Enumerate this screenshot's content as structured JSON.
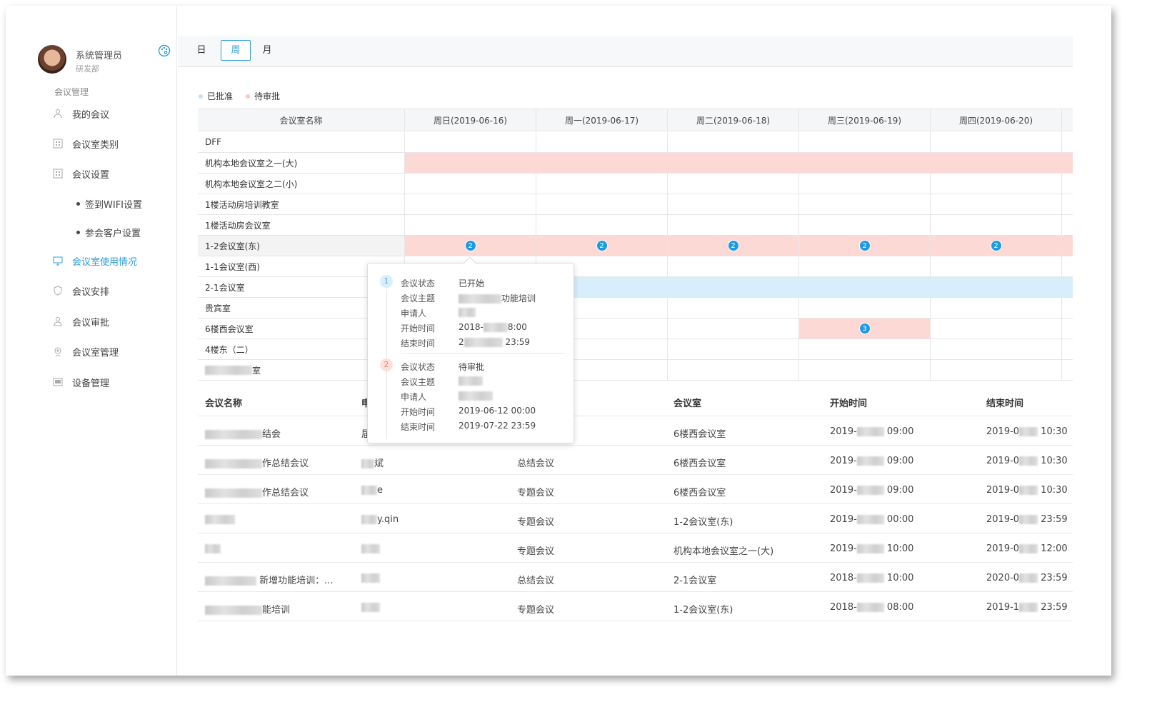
{
  "user": {
    "name": "系统管理员",
    "dept": "研发部"
  },
  "nav": {
    "section_title": "会议管理",
    "items": [
      {
        "label": "我的会议",
        "icon": "users-icon"
      },
      {
        "label": "会议室类别",
        "icon": "grid-icon"
      },
      {
        "label": "会议设置",
        "icon": "grid-icon"
      },
      {
        "label": "会议室使用情况",
        "icon": "monitor-icon",
        "active": true
      },
      {
        "label": "会议安排",
        "icon": "shield-icon"
      },
      {
        "label": "会议审批",
        "icon": "user-check-icon"
      },
      {
        "label": "会议室管理",
        "icon": "projector-icon"
      },
      {
        "label": "设备管理",
        "icon": "device-icon"
      }
    ],
    "sub_items": [
      "签到WIFI设置",
      "参会客户设置"
    ]
  },
  "tabs": [
    {
      "label": "日"
    },
    {
      "label": "周",
      "active": true
    },
    {
      "label": "月"
    }
  ],
  "legend": {
    "approved": "已批准",
    "pending": "待审批",
    "approved_color": "#d7eefb",
    "pending_color": "#fdd9d5"
  },
  "schedule": {
    "header": [
      "会议室名称",
      "周日(2019-06-16)",
      "周一(2019-06-17)",
      "周二(2019-06-18)",
      "周三(2019-06-19)",
      "周四(2019-06-20)"
    ],
    "rooms": [
      "DFF",
      "机构本地会议室之一(大)",
      "机构本地会议室之二(小)",
      "1楼活动房培训教室",
      "1楼活动房会议室",
      "1-2会议室(东)",
      "1-1会议室(西)",
      "2-1会议室",
      "贵宾室",
      "6楼西会议室",
      "4楼东（二）",
      "室"
    ],
    "badges": {
      "r5": "2",
      "r9": "3"
    }
  },
  "list": {
    "headers": [
      "会议名称",
      "申",
      "",
      "会议室",
      "开始时间",
      "结束时间"
    ],
    "rows": [
      {
        "name": "结会",
        "applicant": "届",
        "type": "",
        "room": "6楼西会议室",
        "start_a": "2019-",
        "start_b": "09:00",
        "end_a": "2019-0",
        "end_b": "10:30"
      },
      {
        "name": "作总结会议",
        "applicant": "斌",
        "type": "总结会议",
        "room": "6楼西会议室",
        "start_a": "2019-",
        "start_b": "09:00",
        "end_a": "2019-0",
        "end_b": "10:30"
      },
      {
        "name": "作总结会议",
        "applicant": "e",
        "type": "专题会议",
        "room": "6楼西会议室",
        "start_a": "2019-",
        "start_b": "09:00",
        "end_a": "2019-0",
        "end_b": "10:30"
      },
      {
        "name": "",
        "applicant": "y.qin",
        "type": "专题会议",
        "room": "1-2会议室(东)",
        "start_a": "2019-",
        "start_b": "00:00",
        "end_a": "2019-0",
        "end_b": "23:59"
      },
      {
        "name": "",
        "applicant": "",
        "type": "专题会议",
        "room": "机构本地会议室之一(大)",
        "start_a": "2019-",
        "start_b": "10:00",
        "end_a": "2019-0",
        "end_b": "12:00"
      },
      {
        "name": "新增功能培训：...",
        "applicant": "",
        "type": "总结会议",
        "room": "2-1会议室",
        "start_a": "2018-",
        "start_b": "10:00",
        "end_a": "2020-0",
        "end_b": "23:59"
      },
      {
        "name": "能培训",
        "applicant": "",
        "type": "专题会议",
        "room": "1-2会议室(东)",
        "start_a": "2018-",
        "start_b": "08:00",
        "end_a": "2019-1",
        "end_b": "23:59"
      }
    ]
  },
  "popover": {
    "item1": {
      "num": "1",
      "status_k": "会议状态",
      "status_v": "已开始",
      "topic_k": "会议主题",
      "topic_v": "功能培训",
      "applicant_k": "申请人",
      "start_k": "开始时间",
      "start_v_a": "2018-",
      "start_v_b": "8:00",
      "end_k": "结束时间",
      "end_v_a": "2",
      "end_v_b": "23:59"
    },
    "item2": {
      "num": "2",
      "status_k": "会议状态",
      "status_v": "待审批",
      "topic_k": "会议主题",
      "applicant_k": "申请人",
      "start_k": "开始时间",
      "start_v": "2019-06-12 00:00",
      "end_k": "结束时间",
      "end_v": "2019-07-22 23:59"
    }
  }
}
